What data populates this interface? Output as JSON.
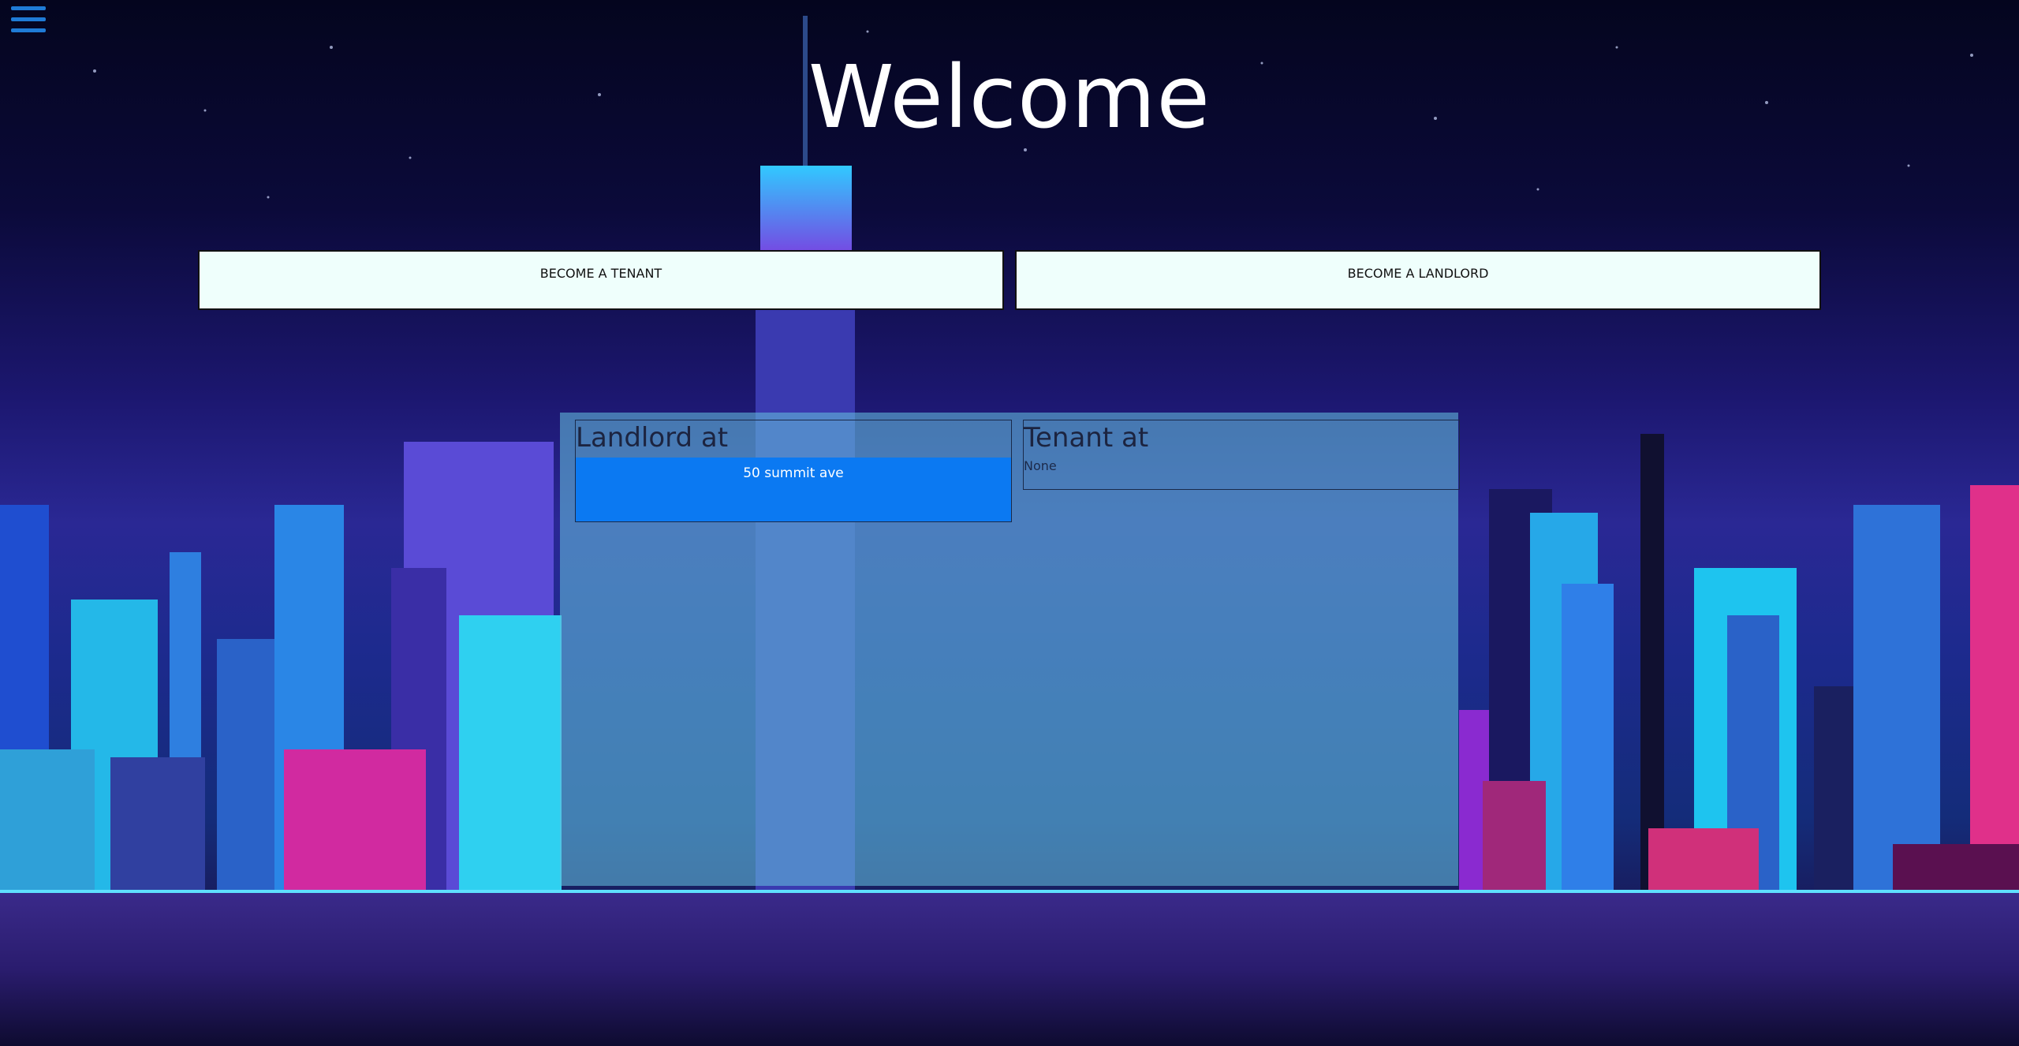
{
  "header": {
    "title": "Welcome",
    "menu_icon": "hamburger-menu-icon"
  },
  "actions": {
    "tenant_label": "BECOME A TENANT",
    "landlord_label": "BECOME A LANDLORD"
  },
  "landlord": {
    "heading": "Landlord at",
    "properties": [
      "50 summit ave"
    ]
  },
  "tenant": {
    "heading": "Tenant at",
    "value": "None"
  },
  "colors": {
    "accent": "#0b79f2",
    "menu": "#1f7bd6",
    "button_bg": "#effffc",
    "panel": "#64bedc"
  }
}
